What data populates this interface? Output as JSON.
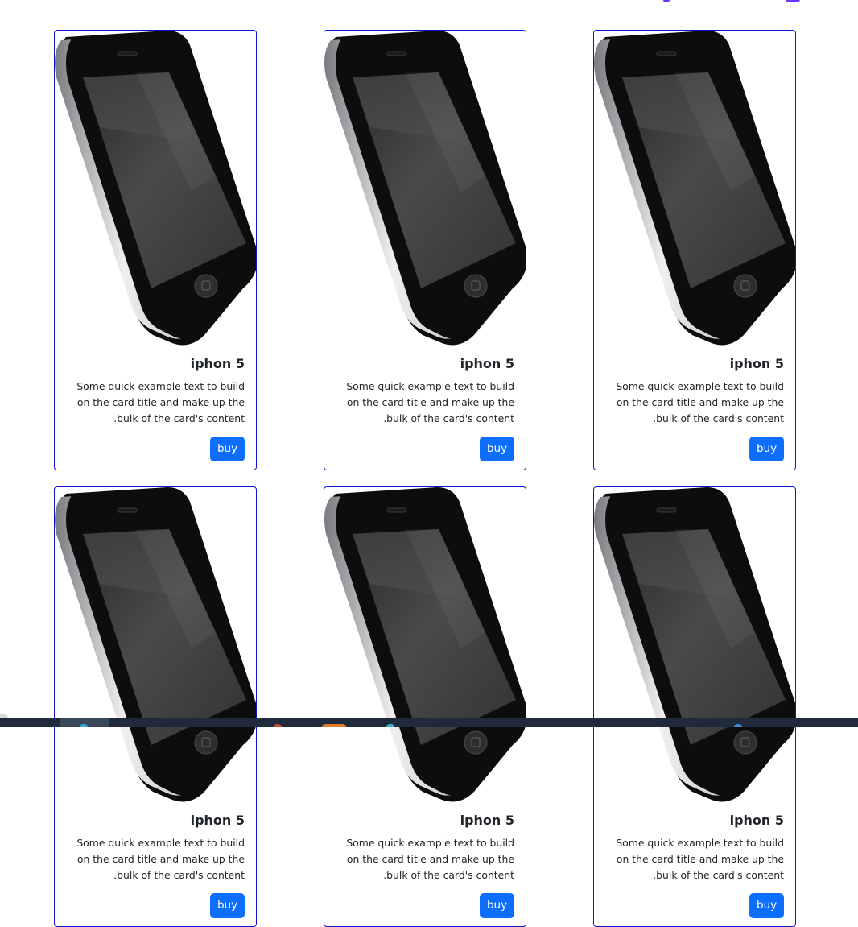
{
  "products": [
    {
      "title": "iphon 5",
      "text": "Some quick example text to build on the card title and make up the bulk of the card's content.",
      "button": "buy"
    },
    {
      "title": "iphon 5",
      "text": "Some quick example text to build on the card title and make up the bulk of the card's content.",
      "button": "buy"
    },
    {
      "title": "iphon 5",
      "text": "Some quick example text to build on the card title and make up the bulk of the card's content.",
      "button": "buy"
    },
    {
      "title": "iphon 5",
      "text": "Some quick example text to build on the card title and make up the bulk of the card's content.",
      "button": "buy"
    },
    {
      "title": "iphon 5",
      "text": "Some quick example text to build on the card title and make up the bulk of the card's content.",
      "button": "buy"
    },
    {
      "title": "iphon 5",
      "text": "Some quick example text to build on the card title and make up the bulk of the card's content.",
      "button": "buy"
    }
  ],
  "colors": {
    "card_border": "#1411d6",
    "button_bg": "#0d6efd",
    "button_text": "#ffffff",
    "text": "#212529",
    "taskbar": "#1f2b3c"
  },
  "icons": {
    "product_image": "smartphone-image",
    "taskbar_active": "browser-icon"
  }
}
